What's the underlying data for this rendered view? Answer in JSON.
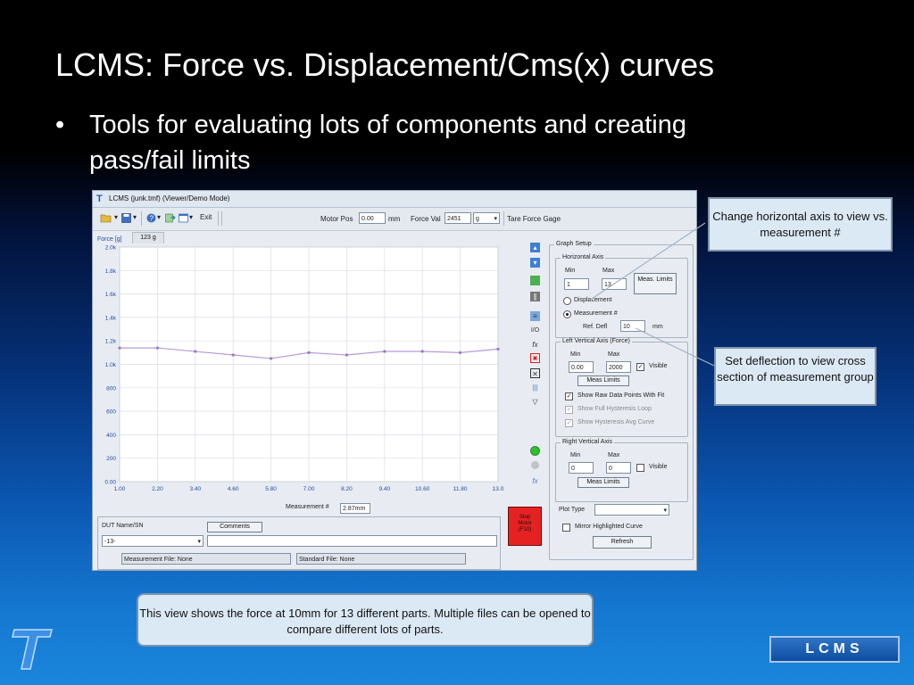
{
  "slide": {
    "title": "LCMS: Force vs. Displacement/Cms(x) curves",
    "bullet": "Tools for evaluating lots of components and creating pass/fail limits",
    "bullet_marker": "•",
    "note": "This view shows the force at 10mm for 13 different parts.  Multiple files can be opened to compare different lots of parts.",
    "callout_horizontal": "Change horizontal axis to view vs. measurement #",
    "callout_deflection": "Set deflection to view cross section of measurement group",
    "badge": "LCMS"
  },
  "window": {
    "title": "LCMS (junk.tmf) (Viewer/Demo Mode)",
    "toolbar": {
      "exit_label": "Exit",
      "motor_pos_label": "Motor Pos",
      "motor_pos_value": "0.00",
      "motor_pos_unit": "mm",
      "force_val_label": "Force Val",
      "force_val_value": "2451",
      "force_unit": "g",
      "tare_label": "Tare Force Gage"
    },
    "plot": {
      "force_label": "Force [g]",
      "tab_value": "123 g",
      "measurement_label": "Measurement #",
      "measurement_value": "2.87mm"
    },
    "bottom": {
      "dut_label": "DUT Name/SN",
      "comments_button": "Comments",
      "dut_value": "-13-",
      "measurement_file": "Measurement File: None",
      "standard_file": "Standard File: None"
    },
    "stop_motor": [
      "Stop",
      "Motor",
      "(F10)"
    ],
    "icons": [
      "page-up-icon",
      "page-down-icon",
      "green-box-icon",
      "pause-icon",
      "list-icon",
      "io-icon",
      "fx-icon",
      "red-box-icon",
      "zoom-box-icon",
      "bars-icon",
      "filter-icon",
      "green-led-icon",
      "gray-led-icon",
      "fx-small-icon"
    ],
    "io_text": "I/O",
    "fx_text": "fx",
    "graph_setup": {
      "title": "Graph Setup",
      "horizontal_axis": {
        "title": "Horizontal Axis",
        "min_label": "Min",
        "max_label": "Max",
        "min_value": "1",
        "max_value": "13",
        "meas_limits": "Meas. Limits",
        "displacement_label": "Displacement",
        "measurement_label": "Measurement #",
        "selected": "Measurement #",
        "ref_defl_label": "Ref. Defl",
        "ref_defl_value": "10",
        "ref_defl_unit": "mm"
      },
      "left_axis": {
        "title": "Left Vertical Axis (Force)",
        "min_label": "Min",
        "max_label": "Max",
        "min_value": "0.00",
        "max_value": "2000",
        "visible_label": "Visible",
        "visible_checked": true,
        "meas_limits": "Meas Limits",
        "show_raw": "Show Raw Data Points With Fit",
        "show_raw_checked": true,
        "show_full": "Show Full Hysteresis Loop",
        "show_avg": "Show Hysteresis Avg Curve"
      },
      "right_axis": {
        "title": "Right Vertical Axis",
        "min_label": "Min",
        "max_label": "Max",
        "min_value": "0",
        "max_value": "0",
        "visible_label": "Visible",
        "visible_checked": false,
        "meas_limits": "Meas Limits"
      },
      "plot_type_label": "Plot Type",
      "plot_type_value": "",
      "mirror_label": "Mirror Highlighted Curve",
      "refresh_label": "Refresh"
    }
  },
  "chart_data": {
    "type": "line",
    "xlabel": "Measurement #",
    "ylabel": "Force [g]",
    "xlim": [
      1,
      13
    ],
    "ylim": [
      0,
      2000
    ],
    "x_ticks": [
      "1.00",
      "2.20",
      "3.40",
      "4.60",
      "5.80",
      "7.00",
      "8.20",
      "9.40",
      "10.60",
      "11.80",
      "13.0"
    ],
    "y_ticks": [
      "0.00",
      "200",
      "400",
      "600",
      "800",
      "1.0k",
      "1.2k",
      "1.4k",
      "1.6k",
      "1.8k",
      "2.0k"
    ],
    "grid": true,
    "color": "#b79ad8",
    "x": [
      1,
      2.2,
      3.4,
      4.6,
      5.8,
      7,
      8.2,
      9.4,
      10.6,
      11.8,
      13
    ],
    "y": [
      1140,
      1140,
      1110,
      1080,
      1050,
      1100,
      1080,
      1110,
      1110,
      1100,
      1130
    ]
  }
}
